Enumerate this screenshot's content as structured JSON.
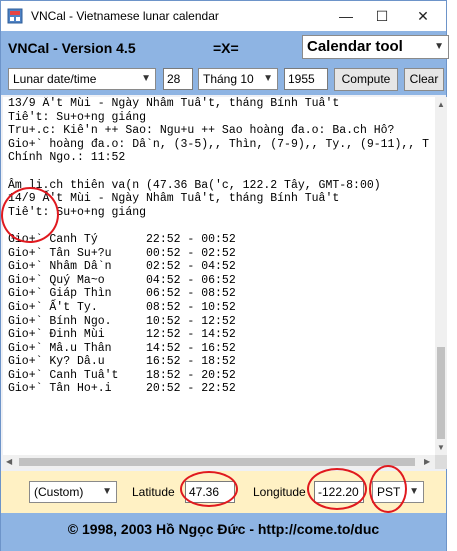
{
  "window": {
    "title": "VNCal - Vietnamese lunar calendar",
    "controls": {
      "minimize": "—",
      "maximize": "☐",
      "close": "✕"
    }
  },
  "banner": {
    "version": "VNCal - Version 4.5",
    "symbol": "=X=",
    "tool_select": "Calendar tool"
  },
  "toolbar": {
    "mode_select": "Lunar date/time",
    "day": "28",
    "month_select": "Tháng 10",
    "year": "1955",
    "compute_label": "Compute",
    "clear_label": "Clear"
  },
  "output": {
    "lines": [
      "13/9 Ấ't Mùi - Ngày Nhâm Tuâ't, tháng Bính Tuâ't",
      "Tiê't: Su+o+ng giáng",
      "Tru+.c: Kiê'n ++ Sao: Ngu+u ++ Sao hoàng đa.o: Ba.ch Hô?",
      "Gio+` hoàng đa.o: Dâ`n, (3-5),, Thìn, (7-9),, Ty., (9-11),, T",
      "Chính Ngo.: 11:52",
      "",
      "Âm li.ch thiên va(n (47.36 Ba('c, 122.2 Tây, GMT-8:00)",
      "14/9 Ấ't Mùi - Ngày Nhâm Tuâ't, tháng Bính Tuâ't",
      "Tiê't: Su+o+ng giáng",
      "",
      "Gio+` Canh Tý       22:52 - 00:52",
      "Gio+` Tân Su+?u     00:52 - 02:52",
      "Gio+` Nhâm Dâ`n     02:52 - 04:52",
      "Gio+` Quý Ma~o      04:52 - 06:52",
      "Gio+` Giáp Thìn     06:52 - 08:52",
      "Gio+` Ấ't Ty.       08:52 - 10:52",
      "Gio+` Bính Ngo.     10:52 - 12:52",
      "Gio+` Đinh Mùi      12:52 - 14:52",
      "Gio+` Mâ.u Thân     14:52 - 16:52",
      "Gio+` Ky? Dâ.u      16:52 - 18:52",
      "Gio+` Canh Tuâ't    18:52 - 20:52",
      "Gio+` Tân Ho+.i     20:52 - 22:52"
    ]
  },
  "location": {
    "preset_select": "(Custom)",
    "latitude_label": "Latitude",
    "latitude_value": "47.36",
    "longitude_label": "Longitude",
    "longitude_value": "-122.20",
    "timezone_select": "PST"
  },
  "footer": {
    "copyright": "© 1998, 2003 Hồ Ngọc Đức - http://come.to/duc"
  },
  "colors": {
    "banner": "#8eb4e3",
    "location_bar": "#fff1c4",
    "annotation": "#e0191f"
  },
  "icons": [
    "app-icon",
    "chevron-down-icon",
    "scroll-up-arrow-icon",
    "scroll-down-arrow-icon",
    "scroll-left-arrow-icon",
    "scroll-right-arrow-icon"
  ]
}
